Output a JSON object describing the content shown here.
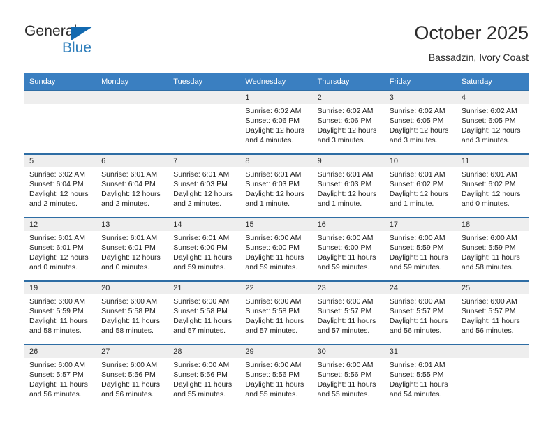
{
  "brand": {
    "word_one": "General",
    "word_two": "Blue",
    "flag_icon": "blue-triangle-flag-icon"
  },
  "header": {
    "title": "October 2025",
    "subtitle": "Bassadzin, Ivory Coast"
  },
  "colors": {
    "header_blue": "#3a7fc1",
    "row_rule_blue": "#2e6da4",
    "daynum_band": "#eeeeee",
    "brand_blue": "#2e7ebb",
    "text": "#2b2b2b"
  },
  "calendar": {
    "weekday_headers": [
      "Sunday",
      "Monday",
      "Tuesday",
      "Wednesday",
      "Thursday",
      "Friday",
      "Saturday"
    ],
    "weeks": [
      [
        {
          "day": "",
          "empty": true,
          "sunrise": "",
          "sunset": "",
          "daylight_line1": "",
          "daylight_line2": ""
        },
        {
          "day": "",
          "empty": true,
          "sunrise": "",
          "sunset": "",
          "daylight_line1": "",
          "daylight_line2": ""
        },
        {
          "day": "",
          "empty": true,
          "sunrise": "",
          "sunset": "",
          "daylight_line1": "",
          "daylight_line2": ""
        },
        {
          "day": "1",
          "empty": false,
          "sunrise": "Sunrise: 6:02 AM",
          "sunset": "Sunset: 6:06 PM",
          "daylight_line1": "Daylight: 12 hours",
          "daylight_line2": "and 4 minutes."
        },
        {
          "day": "2",
          "empty": false,
          "sunrise": "Sunrise: 6:02 AM",
          "sunset": "Sunset: 6:06 PM",
          "daylight_line1": "Daylight: 12 hours",
          "daylight_line2": "and 3 minutes."
        },
        {
          "day": "3",
          "empty": false,
          "sunrise": "Sunrise: 6:02 AM",
          "sunset": "Sunset: 6:05 PM",
          "daylight_line1": "Daylight: 12 hours",
          "daylight_line2": "and 3 minutes."
        },
        {
          "day": "4",
          "empty": false,
          "sunrise": "Sunrise: 6:02 AM",
          "sunset": "Sunset: 6:05 PM",
          "daylight_line1": "Daylight: 12 hours",
          "daylight_line2": "and 3 minutes."
        }
      ],
      [
        {
          "day": "5",
          "empty": false,
          "sunrise": "Sunrise: 6:02 AM",
          "sunset": "Sunset: 6:04 PM",
          "daylight_line1": "Daylight: 12 hours",
          "daylight_line2": "and 2 minutes."
        },
        {
          "day": "6",
          "empty": false,
          "sunrise": "Sunrise: 6:01 AM",
          "sunset": "Sunset: 6:04 PM",
          "daylight_line1": "Daylight: 12 hours",
          "daylight_line2": "and 2 minutes."
        },
        {
          "day": "7",
          "empty": false,
          "sunrise": "Sunrise: 6:01 AM",
          "sunset": "Sunset: 6:03 PM",
          "daylight_line1": "Daylight: 12 hours",
          "daylight_line2": "and 2 minutes."
        },
        {
          "day": "8",
          "empty": false,
          "sunrise": "Sunrise: 6:01 AM",
          "sunset": "Sunset: 6:03 PM",
          "daylight_line1": "Daylight: 12 hours",
          "daylight_line2": "and 1 minute."
        },
        {
          "day": "9",
          "empty": false,
          "sunrise": "Sunrise: 6:01 AM",
          "sunset": "Sunset: 6:03 PM",
          "daylight_line1": "Daylight: 12 hours",
          "daylight_line2": "and 1 minute."
        },
        {
          "day": "10",
          "empty": false,
          "sunrise": "Sunrise: 6:01 AM",
          "sunset": "Sunset: 6:02 PM",
          "daylight_line1": "Daylight: 12 hours",
          "daylight_line2": "and 1 minute."
        },
        {
          "day": "11",
          "empty": false,
          "sunrise": "Sunrise: 6:01 AM",
          "sunset": "Sunset: 6:02 PM",
          "daylight_line1": "Daylight: 12 hours",
          "daylight_line2": "and 0 minutes."
        }
      ],
      [
        {
          "day": "12",
          "empty": false,
          "sunrise": "Sunrise: 6:01 AM",
          "sunset": "Sunset: 6:01 PM",
          "daylight_line1": "Daylight: 12 hours",
          "daylight_line2": "and 0 minutes."
        },
        {
          "day": "13",
          "empty": false,
          "sunrise": "Sunrise: 6:01 AM",
          "sunset": "Sunset: 6:01 PM",
          "daylight_line1": "Daylight: 12 hours",
          "daylight_line2": "and 0 minutes."
        },
        {
          "day": "14",
          "empty": false,
          "sunrise": "Sunrise: 6:01 AM",
          "sunset": "Sunset: 6:00 PM",
          "daylight_line1": "Daylight: 11 hours",
          "daylight_line2": "and 59 minutes."
        },
        {
          "day": "15",
          "empty": false,
          "sunrise": "Sunrise: 6:00 AM",
          "sunset": "Sunset: 6:00 PM",
          "daylight_line1": "Daylight: 11 hours",
          "daylight_line2": "and 59 minutes."
        },
        {
          "day": "16",
          "empty": false,
          "sunrise": "Sunrise: 6:00 AM",
          "sunset": "Sunset: 6:00 PM",
          "daylight_line1": "Daylight: 11 hours",
          "daylight_line2": "and 59 minutes."
        },
        {
          "day": "17",
          "empty": false,
          "sunrise": "Sunrise: 6:00 AM",
          "sunset": "Sunset: 5:59 PM",
          "daylight_line1": "Daylight: 11 hours",
          "daylight_line2": "and 59 minutes."
        },
        {
          "day": "18",
          "empty": false,
          "sunrise": "Sunrise: 6:00 AM",
          "sunset": "Sunset: 5:59 PM",
          "daylight_line1": "Daylight: 11 hours",
          "daylight_line2": "and 58 minutes."
        }
      ],
      [
        {
          "day": "19",
          "empty": false,
          "sunrise": "Sunrise: 6:00 AM",
          "sunset": "Sunset: 5:59 PM",
          "daylight_line1": "Daylight: 11 hours",
          "daylight_line2": "and 58 minutes."
        },
        {
          "day": "20",
          "empty": false,
          "sunrise": "Sunrise: 6:00 AM",
          "sunset": "Sunset: 5:58 PM",
          "daylight_line1": "Daylight: 11 hours",
          "daylight_line2": "and 58 minutes."
        },
        {
          "day": "21",
          "empty": false,
          "sunrise": "Sunrise: 6:00 AM",
          "sunset": "Sunset: 5:58 PM",
          "daylight_line1": "Daylight: 11 hours",
          "daylight_line2": "and 57 minutes."
        },
        {
          "day": "22",
          "empty": false,
          "sunrise": "Sunrise: 6:00 AM",
          "sunset": "Sunset: 5:58 PM",
          "daylight_line1": "Daylight: 11 hours",
          "daylight_line2": "and 57 minutes."
        },
        {
          "day": "23",
          "empty": false,
          "sunrise": "Sunrise: 6:00 AM",
          "sunset": "Sunset: 5:57 PM",
          "daylight_line1": "Daylight: 11 hours",
          "daylight_line2": "and 57 minutes."
        },
        {
          "day": "24",
          "empty": false,
          "sunrise": "Sunrise: 6:00 AM",
          "sunset": "Sunset: 5:57 PM",
          "daylight_line1": "Daylight: 11 hours",
          "daylight_line2": "and 56 minutes."
        },
        {
          "day": "25",
          "empty": false,
          "sunrise": "Sunrise: 6:00 AM",
          "sunset": "Sunset: 5:57 PM",
          "daylight_line1": "Daylight: 11 hours",
          "daylight_line2": "and 56 minutes."
        }
      ],
      [
        {
          "day": "26",
          "empty": false,
          "sunrise": "Sunrise: 6:00 AM",
          "sunset": "Sunset: 5:57 PM",
          "daylight_line1": "Daylight: 11 hours",
          "daylight_line2": "and 56 minutes."
        },
        {
          "day": "27",
          "empty": false,
          "sunrise": "Sunrise: 6:00 AM",
          "sunset": "Sunset: 5:56 PM",
          "daylight_line1": "Daylight: 11 hours",
          "daylight_line2": "and 56 minutes."
        },
        {
          "day": "28",
          "empty": false,
          "sunrise": "Sunrise: 6:00 AM",
          "sunset": "Sunset: 5:56 PM",
          "daylight_line1": "Daylight: 11 hours",
          "daylight_line2": "and 55 minutes."
        },
        {
          "day": "29",
          "empty": false,
          "sunrise": "Sunrise: 6:00 AM",
          "sunset": "Sunset: 5:56 PM",
          "daylight_line1": "Daylight: 11 hours",
          "daylight_line2": "and 55 minutes."
        },
        {
          "day": "30",
          "empty": false,
          "sunrise": "Sunrise: 6:00 AM",
          "sunset": "Sunset: 5:56 PM",
          "daylight_line1": "Daylight: 11 hours",
          "daylight_line2": "and 55 minutes."
        },
        {
          "day": "31",
          "empty": false,
          "sunrise": "Sunrise: 6:01 AM",
          "sunset": "Sunset: 5:55 PM",
          "daylight_line1": "Daylight: 11 hours",
          "daylight_line2": "and 54 minutes."
        },
        {
          "day": "",
          "empty": true,
          "sunrise": "",
          "sunset": "",
          "daylight_line1": "",
          "daylight_line2": ""
        }
      ]
    ]
  }
}
